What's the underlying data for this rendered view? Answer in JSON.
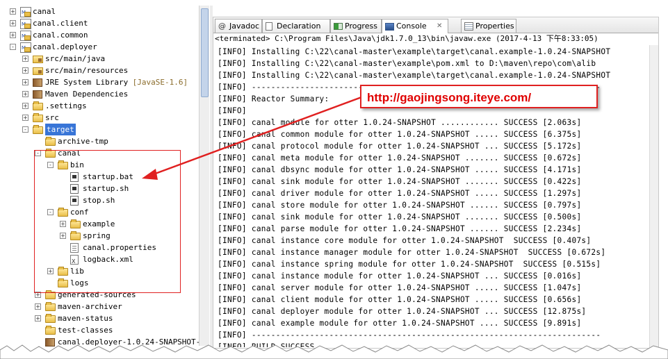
{
  "tree": {
    "items": [
      {
        "label": "canal",
        "exp": "+",
        "icon": "maven-project-icon",
        "indent": 0
      },
      {
        "label": "canal.client",
        "exp": "+",
        "icon": "maven-project-icon",
        "indent": 0
      },
      {
        "label": "canal.common",
        "exp": "+",
        "icon": "maven-project-icon",
        "indent": 0
      },
      {
        "label": "canal.deployer",
        "exp": "-",
        "icon": "maven-project-icon",
        "indent": 0
      },
      {
        "label": "src/main/java",
        "exp": "+",
        "icon": "source-folder-icon",
        "indent": 1
      },
      {
        "label": "src/main/resources",
        "exp": "+",
        "icon": "source-folder-icon",
        "indent": 1
      },
      {
        "label": "JRE System Library",
        "suffix": "[JavaSE-1.6]",
        "exp": "+",
        "icon": "library-icon",
        "indent": 1
      },
      {
        "label": "Maven Dependencies",
        "exp": "+",
        "icon": "library-icon",
        "indent": 1
      },
      {
        "label": ".settings",
        "exp": "+",
        "icon": "folder-icon",
        "indent": 1
      },
      {
        "label": "src",
        "exp": "+",
        "icon": "folder-icon",
        "indent": 1
      },
      {
        "label": "target",
        "exp": "-",
        "icon": "folder-icon",
        "indent": 1,
        "selected": true
      },
      {
        "label": "archive-tmp",
        "exp": "",
        "icon": "folder-icon",
        "indent": 2
      },
      {
        "label": "canal",
        "exp": "-",
        "icon": "folder-icon",
        "indent": 2
      },
      {
        "label": "bin",
        "exp": "-",
        "icon": "folder-icon",
        "indent": 3
      },
      {
        "label": "startup.bat",
        "exp": "",
        "icon": "script-file-icon",
        "indent": 4
      },
      {
        "label": "startup.sh",
        "exp": "",
        "icon": "script-file-icon",
        "indent": 4
      },
      {
        "label": "stop.sh",
        "exp": "",
        "icon": "script-file-icon",
        "indent": 4
      },
      {
        "label": "conf",
        "exp": "-",
        "icon": "folder-icon",
        "indent": 3
      },
      {
        "label": "example",
        "exp": "+",
        "icon": "folder-icon",
        "indent": 4
      },
      {
        "label": "spring",
        "exp": "+",
        "icon": "folder-icon",
        "indent": 4
      },
      {
        "label": "canal.properties",
        "exp": "",
        "icon": "properties-file-icon",
        "indent": 4
      },
      {
        "label": "logback.xml",
        "exp": "",
        "icon": "xml-file-icon",
        "indent": 4
      },
      {
        "label": "lib",
        "exp": "+",
        "icon": "folder-icon",
        "indent": 3
      },
      {
        "label": "logs",
        "exp": "",
        "icon": "folder-icon",
        "indent": 3
      },
      {
        "label": "generated-sources",
        "exp": "+",
        "icon": "folder-icon",
        "indent": 2
      },
      {
        "label": "maven-archiver",
        "exp": "+",
        "icon": "folder-icon",
        "indent": 2
      },
      {
        "label": "maven-status",
        "exp": "+",
        "icon": "folder-icon",
        "indent": 2
      },
      {
        "label": "test-classes",
        "exp": "",
        "icon": "folder-icon",
        "indent": 2
      },
      {
        "label": "canal.deployer-1.0.24-SNAPSHOT-",
        "exp": "",
        "icon": "archive-file-icon",
        "indent": 2
      }
    ]
  },
  "tabs": [
    {
      "label": "Javadoc",
      "icon": "javadoc-icon"
    },
    {
      "label": "Declaration",
      "icon": "declaration-icon"
    },
    {
      "label": "Progress",
      "icon": "progress-icon"
    },
    {
      "label": "Console",
      "icon": "console-icon",
      "active": true,
      "close": "✕"
    },
    {
      "label": "Properties",
      "icon": "properties-icon"
    }
  ],
  "console": {
    "terminated": "<terminated> C:\\Program Files\\Java\\jdk1.7.0_13\\bin\\javaw.exe (2017-4-13 下午8:33:05)",
    "lines": [
      "[INFO] Installing C:\\22\\canal-master\\example\\target\\canal.example-1.0.24-SNAPSHOT",
      "[INFO] Installing C:\\22\\canal-master\\example\\pom.xml to D:\\maven\\repo\\com\\alib",
      "[INFO] Installing C:\\22\\canal-master\\example\\target\\canal.example-1.0.24-SNAPSHOT",
      "[INFO] ------------------------------------------------------------------------",
      "[INFO] Reactor Summary:",
      "[INFO]",
      "[INFO] canal module for otter 1.0.24-SNAPSHOT ............ SUCCESS [2.063s]",
      "[INFO] canal common module for otter 1.0.24-SNAPSHOT ..... SUCCESS [6.375s]",
      "[INFO] canal protocol module for otter 1.0.24-SNAPSHOT ... SUCCESS [5.172s]",
      "[INFO] canal meta module for otter 1.0.24-SNAPSHOT ....... SUCCESS [0.672s]",
      "[INFO] canal dbsync module for otter 1.0.24-SNAPSHOT ..... SUCCESS [4.171s]",
      "[INFO] canal sink module for otter 1.0.24-SNAPSHOT ....... SUCCESS [0.422s]",
      "[INFO] canal driver module for otter 1.0.24-SNAPSHOT ..... SUCCESS [1.297s]",
      "[INFO] canal store module for otter 1.0.24-SNAPSHOT ...... SUCCESS [0.797s]",
      "[INFO] canal sink module for otter 1.0.24-SNAPSHOT ....... SUCCESS [0.500s]",
      "[INFO] canal parse module for otter 1.0.24-SNAPSHOT ...... SUCCESS [2.234s]",
      "[INFO] canal instance core module for otter 1.0.24-SNAPSHOT  SUCCESS [0.407s]",
      "[INFO] canal instance manager module for otter 1.0.24-SNAPSHOT  SUCCESS [0.672s]",
      "[INFO] canal instance spring module for otter 1.0.24-SNAPSHOT  SUCCESS [0.515s]",
      "[INFO] canal instance module for otter 1.0.24-SNAPSHOT ... SUCCESS [0.016s]",
      "[INFO] canal server module for otter 1.0.24-SNAPSHOT ..... SUCCESS [1.047s]",
      "[INFO] canal client module for otter 1.0.24-SNAPSHOT ..... SUCCESS [0.656s]",
      "[INFO] canal deployer module for otter 1.0.24-SNAPSHOT ... SUCCESS [12.875s]",
      "[INFO] canal example module for otter 1.0.24-SNAPSHOT .... SUCCESS [9.891s]",
      "[INFO] ------------------------------------------------------------------------",
      "[INFO] BUILD SUCCESS"
    ]
  },
  "annotation": {
    "url": "http://gaojingsong.iteye.com/",
    "color": "#e00000"
  }
}
